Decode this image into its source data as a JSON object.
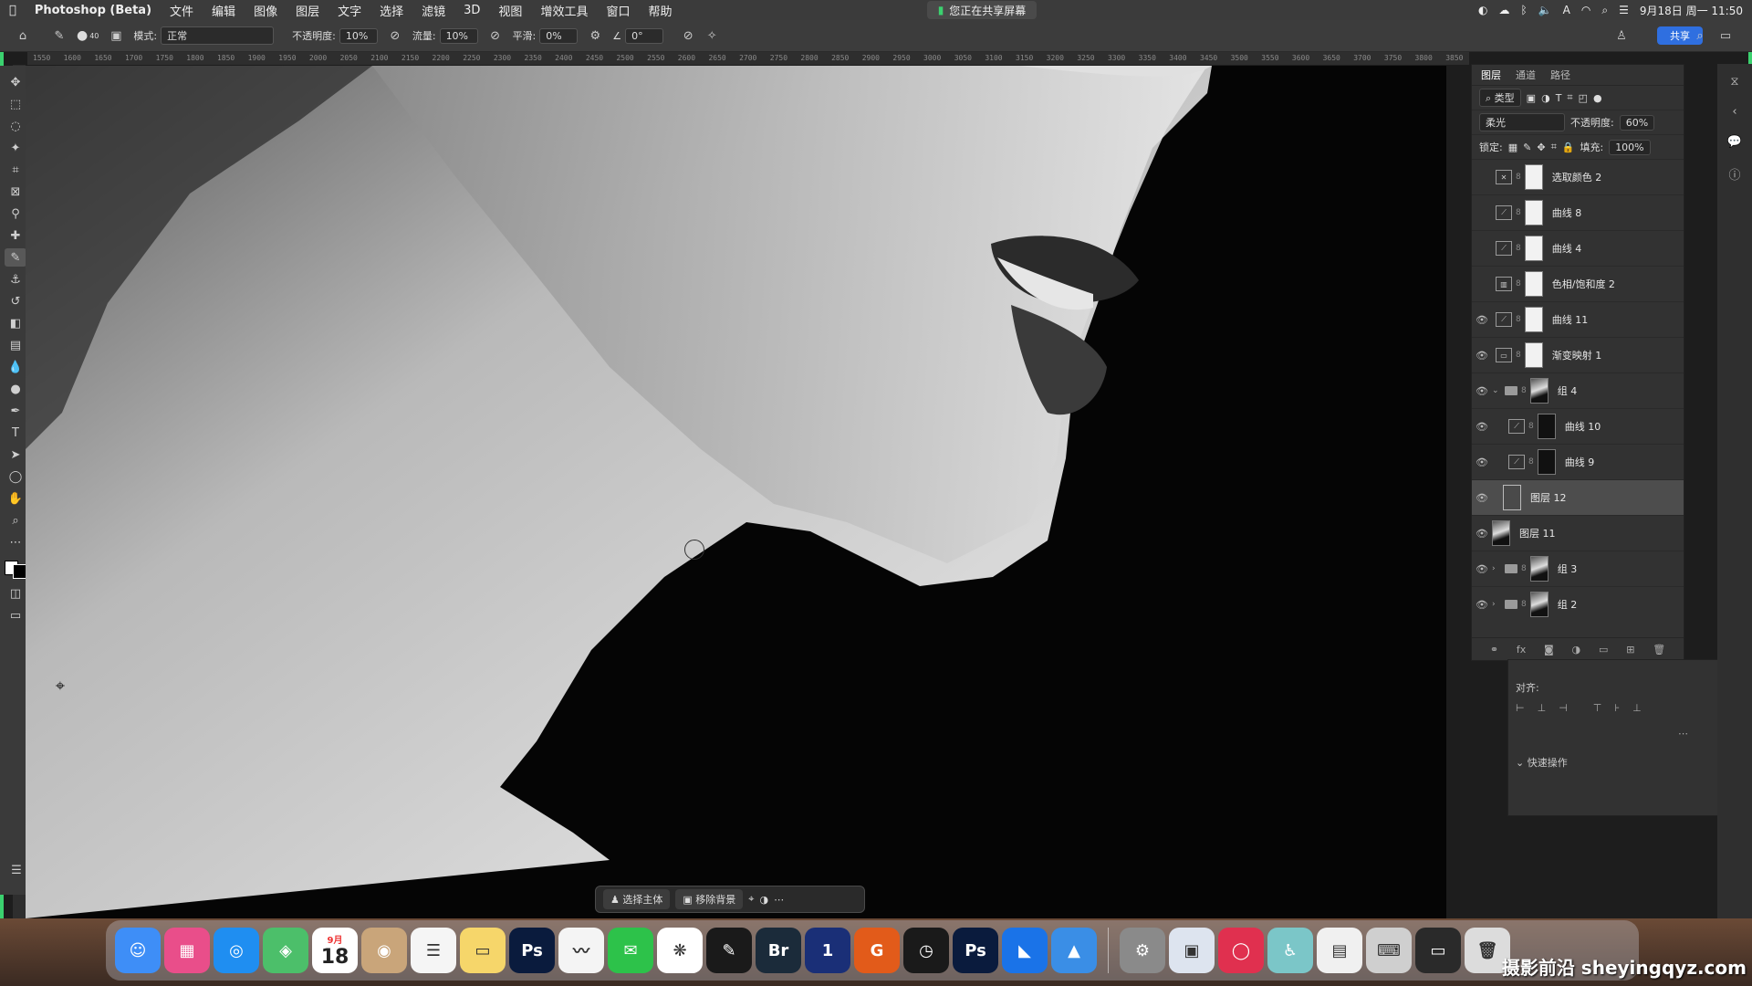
{
  "menubar": {
    "app_name": "Photoshop (Beta)",
    "items": [
      "文件",
      "编辑",
      "图像",
      "图层",
      "文字",
      "选择",
      "滤镜",
      "3D",
      "视图",
      "增效工具",
      "窗口",
      "帮助"
    ],
    "sharing": "您正在共享屏幕",
    "datetime": "9月18日 周一 11:50"
  },
  "options": {
    "mode_label": "模式:",
    "mode_value": "正常",
    "opacity_label": "不透明度:",
    "opacity_value": "10%",
    "flow_label": "流量:",
    "flow_value": "10%",
    "smooth_label": "平滑:",
    "smooth_value": "0%",
    "angle_value": "0°",
    "brush_size": "40",
    "share_label": "共享"
  },
  "ruler": {
    "ticks": [
      "1550",
      "1600",
      "1650",
      "1700",
      "1750",
      "1800",
      "1850",
      "1900",
      "1950",
      "2000",
      "2050",
      "2100",
      "2150",
      "2200",
      "2250",
      "2300",
      "2350",
      "2400",
      "2450",
      "2500",
      "2550",
      "2600",
      "2650",
      "2700",
      "2750",
      "2800",
      "2850",
      "2900",
      "2950",
      "3000",
      "3050",
      "3100",
      "3150",
      "3200",
      "3250",
      "3300",
      "3350",
      "3400",
      "3450",
      "3500",
      "3550",
      "3600",
      "3650",
      "3700",
      "3750",
      "3800",
      "3850"
    ]
  },
  "layers_panel": {
    "tabs": [
      "图层",
      "通道",
      "路径"
    ],
    "filter_label": "类型",
    "blend_mode": "柔光",
    "opacity_label": "不透明度:",
    "opacity_value": "60%",
    "lock_label": "锁定:",
    "fill_label": "填充:",
    "fill_value": "100%",
    "layers": [
      {
        "name": "选取颜色 2",
        "visible": false,
        "kind": "adjustment",
        "icon": "selective-color-icon"
      },
      {
        "name": "曲线 8",
        "visible": false,
        "kind": "adjustment",
        "icon": "curves-icon"
      },
      {
        "name": "曲线 4",
        "visible": false,
        "kind": "adjustment",
        "icon": "curves-icon"
      },
      {
        "name": "色相/饱和度 2",
        "visible": false,
        "kind": "adjustment",
        "icon": "hue-saturation-icon"
      },
      {
        "name": "曲线 11",
        "visible": true,
        "kind": "adjustment",
        "icon": "curves-icon"
      },
      {
        "name": "渐变映射 1",
        "visible": true,
        "kind": "adjustment",
        "icon": "gradient-map-icon"
      },
      {
        "name": "组 4",
        "visible": true,
        "kind": "group-open",
        "icon": "folder-icon"
      },
      {
        "name": "曲线 10",
        "visible": true,
        "kind": "adjustment-child",
        "icon": "curves-icon"
      },
      {
        "name": "曲线 9",
        "visible": true,
        "kind": "adjustment-child",
        "icon": "curves-icon"
      },
      {
        "name": "图层 12",
        "visible": true,
        "kind": "pixel-selected",
        "icon": "layer-icon"
      },
      {
        "name": "图层 11",
        "visible": true,
        "kind": "pixel-photo",
        "icon": "layer-icon"
      },
      {
        "name": "组 3",
        "visible": true,
        "kind": "group-closed",
        "icon": "folder-icon"
      },
      {
        "name": "组 2",
        "visible": true,
        "kind": "group-closed",
        "icon": "folder-icon"
      }
    ]
  },
  "properties": {
    "align_label": "对齐:",
    "quick_actions": "快速操作"
  },
  "taskbar": {
    "select_subject": "选择主体",
    "remove_background": "移除背景"
  },
  "dock": {
    "calendar_month": "9月",
    "calendar_day": "18",
    "apps": [
      "Finder",
      "Launchpad",
      "Safari",
      "Maps",
      "Calendar",
      "Contacts",
      "Reminders",
      "Notes",
      "Photoshop",
      "Freeform",
      "WeChat",
      "Baidu Netdisk",
      "Final Draft",
      "Bridge",
      "1Password",
      "Grammarly",
      "Screen Recorder",
      "Photoshop Beta",
      "ToDesk",
      "Keynote",
      "System Settings",
      "Preview",
      "Creative Cloud",
      "Accessibility",
      "Files",
      "Keyboard",
      "Screenshot",
      "Trash"
    ],
    "colors": [
      "#3e8ef7",
      "#e94e8a",
      "#1f8ef1",
      "#4cbf6a",
      "#ffffff",
      "#c9a57a",
      "#f5f5f5",
      "#f6d66a",
      "#0a1b3d",
      "#f4f4f4",
      "#2dc24a",
      "#ffffff",
      "#1a1a1a",
      "#1b2b3a",
      "#1a2f77",
      "#e25b1a",
      "#1a1a1a",
      "#0a1b3d",
      "#1a73e8",
      "#3a8ee6",
      "#8a8a8a",
      "#dde4ef",
      "#e0304f",
      "#7bc6c8",
      "#f0f0f0",
      "#cfcfcf",
      "#2a2a2a",
      "#dcdcdc"
    ]
  },
  "watermark": "摄影前沿 sheyingqyz.com"
}
